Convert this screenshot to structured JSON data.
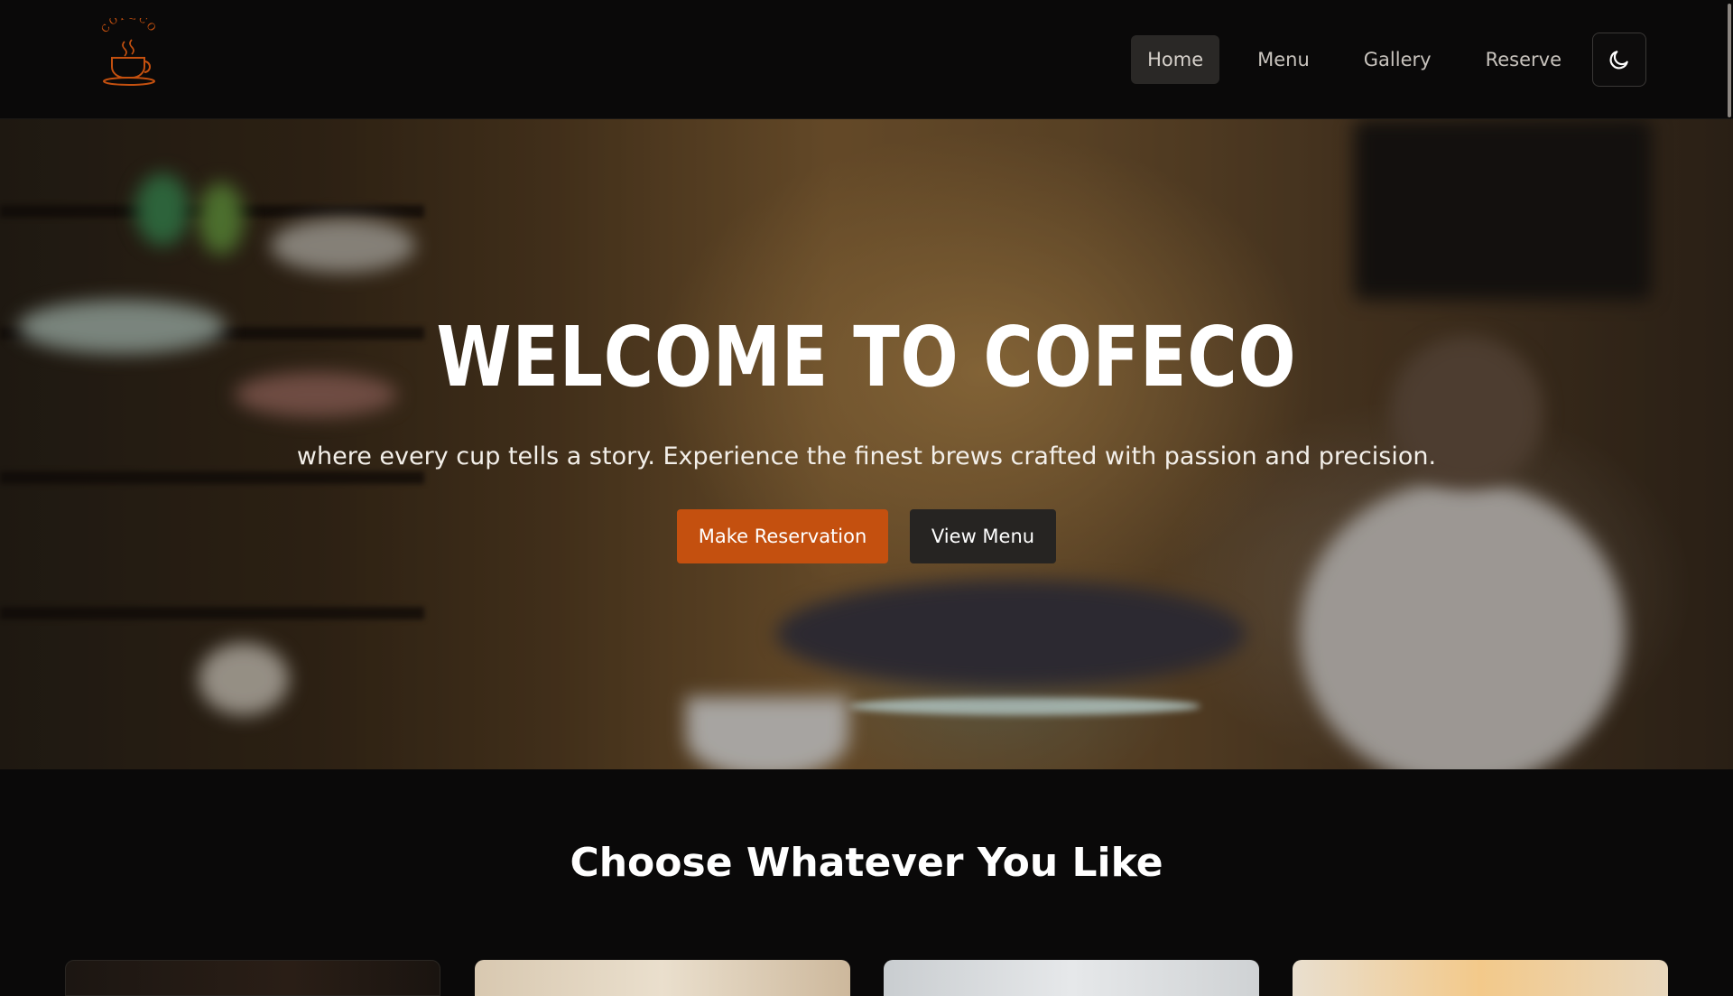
{
  "header": {
    "logo": {
      "text": "COFECO",
      "icon": "coffee-cup-icon",
      "color": "#c4500f"
    },
    "nav": [
      {
        "label": "Home",
        "active": true
      },
      {
        "label": "Menu",
        "active": false
      },
      {
        "label": "Gallery",
        "active": false
      },
      {
        "label": "Reserve",
        "active": false
      }
    ],
    "theme_toggle_icon": "moon-icon"
  },
  "hero": {
    "title": "WELCOME TO COFECO",
    "subtitle": "where every cup tells a story. Experience the finest brews crafted with passion and precision.",
    "primary_button": "Make Reservation",
    "secondary_button": "View Menu",
    "accent_color": "#c4500f"
  },
  "section": {
    "title": "Choose Whatever You Like"
  }
}
